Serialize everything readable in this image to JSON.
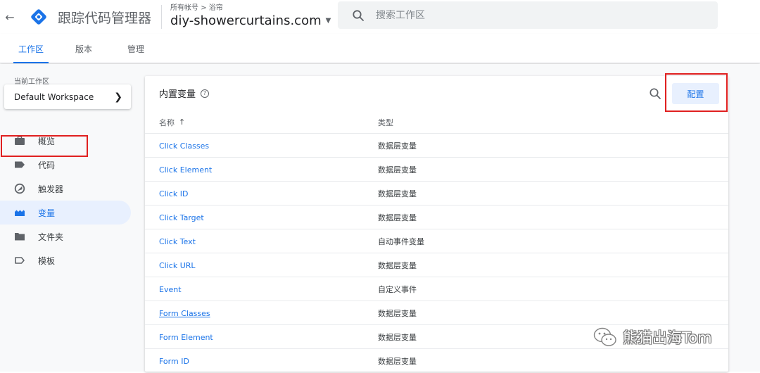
{
  "header": {
    "back_icon": "arrow-back-icon",
    "app_title": "跟踪代码管理器",
    "breadcrumb": "所有帐号 > 浴帘",
    "container_name": "diy-showercurtains.com",
    "search_placeholder": "搜索工作区",
    "logo_color": "#1a73e8"
  },
  "tabs": [
    {
      "label": "工作区",
      "active": true
    },
    {
      "label": "版本",
      "active": false
    },
    {
      "label": "管理",
      "active": false
    }
  ],
  "sidebar": {
    "workspace_label": "当前工作区",
    "workspace_name": "Default Workspace",
    "items": [
      {
        "label": "概览",
        "icon": "briefcase-icon"
      },
      {
        "label": "代码",
        "icon": "tag-icon"
      },
      {
        "label": "触发器",
        "icon": "trigger-icon"
      },
      {
        "label": "变量",
        "icon": "variables-icon",
        "active": true
      },
      {
        "label": "文件夹",
        "icon": "folder-icon"
      },
      {
        "label": "模板",
        "icon": "template-icon"
      }
    ]
  },
  "main": {
    "card_title": "内置变量",
    "help_glyph": "?",
    "configure_button": "配置",
    "columns": {
      "name": "名称",
      "type": "类型"
    },
    "rows": [
      {
        "name": "Click Classes",
        "type": "数据层变量"
      },
      {
        "name": "Click Element",
        "type": "数据层变量"
      },
      {
        "name": "Click ID",
        "type": "数据层变量"
      },
      {
        "name": "Click Target",
        "type": "数据层变量"
      },
      {
        "name": "Click Text",
        "type": "自动事件变量"
      },
      {
        "name": "Click URL",
        "type": "数据层变量"
      },
      {
        "name": "Event",
        "type": "自定义事件"
      },
      {
        "name": "Form Classes",
        "type": "数据层变量"
      },
      {
        "name": "Form Element",
        "type": "数据层变量"
      },
      {
        "name": "Form ID",
        "type": "数据层变量"
      }
    ]
  },
  "watermark": {
    "text": "熊猫出海Tom"
  },
  "colors": {
    "accent": "#1a73e8",
    "highlight": "#e02020",
    "active_bg": "#e8f0fe"
  }
}
